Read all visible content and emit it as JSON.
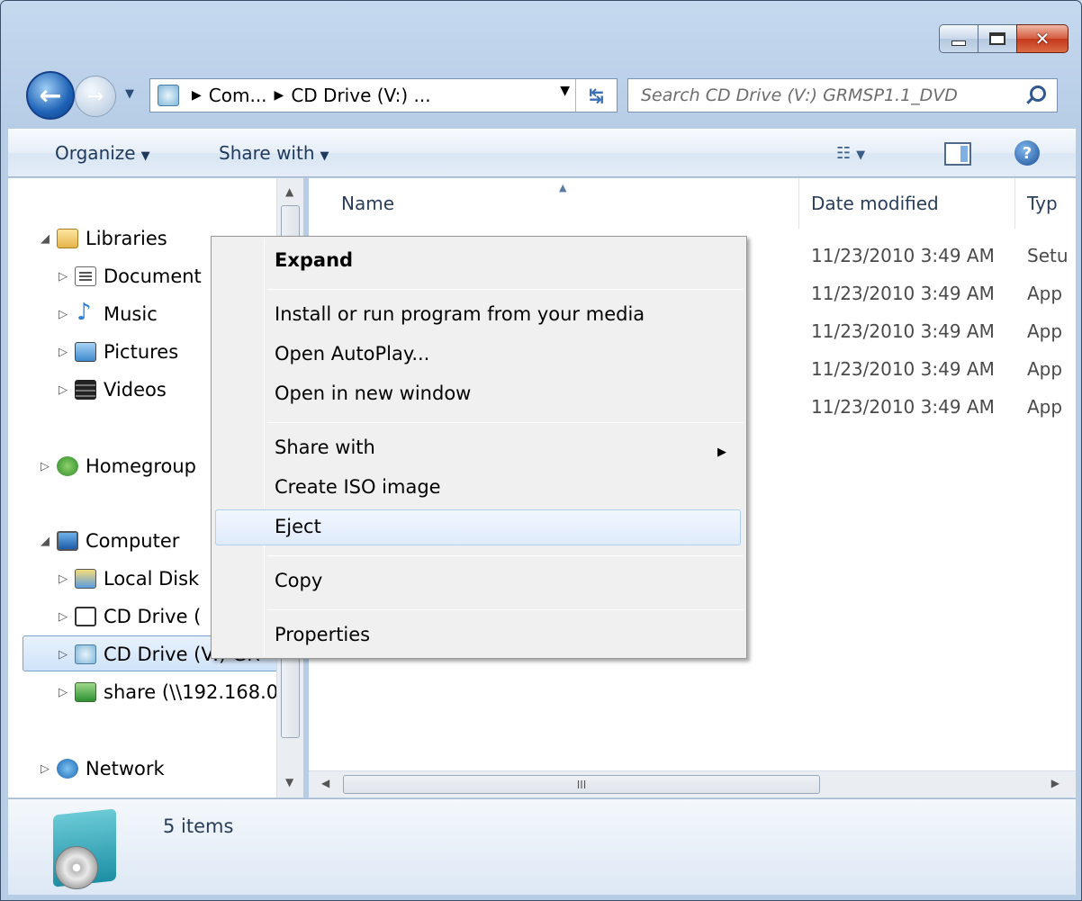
{
  "window": {
    "caption_close": "✕"
  },
  "nav": {
    "breadcrumb": [
      "Com...",
      "CD Drive (V:) ..."
    ],
    "search_placeholder": "Search CD Drive (V:) GRMSP1.1_DVD"
  },
  "toolbar": {
    "organize": "Organize",
    "share_with": "Share with"
  },
  "tree": {
    "libraries": "Libraries",
    "documents": "Document",
    "music": "Music",
    "pictures": "Pictures",
    "videos": "Videos",
    "homegroup": "Homegroup",
    "computer": "Computer",
    "local_disk": "Local Disk",
    "cd_drive_1": "CD Drive (",
    "cd_drive_2": "CD Drive (V:) GR",
    "share": "share (\\\\192.168.0",
    "network": "Network"
  },
  "columns": {
    "name": "Name",
    "date": "Date modified",
    "type": "Typ"
  },
  "rows": [
    {
      "date": "11/23/2010 3:49 AM",
      "type": "Setu"
    },
    {
      "date": "11/23/2010 3:49 AM",
      "type": "App"
    },
    {
      "date": "11/23/2010 3:49 AM",
      "type": "App"
    },
    {
      "date": "11/23/2010 3:49 AM",
      "type": "App"
    },
    {
      "date": "11/23/2010 3:49 AM",
      "type": "App"
    }
  ],
  "status": {
    "count": "5 items"
  },
  "context_menu": {
    "expand": "Expand",
    "install": "Install or run program from your media",
    "autoplay": "Open AutoPlay...",
    "new_window": "Open in new window",
    "share_with": "Share with",
    "create_iso": "Create ISO image",
    "eject": "Eject",
    "copy": "Copy",
    "properties": "Properties"
  },
  "colors": {
    "accent": "#3a6fb6",
    "highlight": "#dfebfb"
  }
}
